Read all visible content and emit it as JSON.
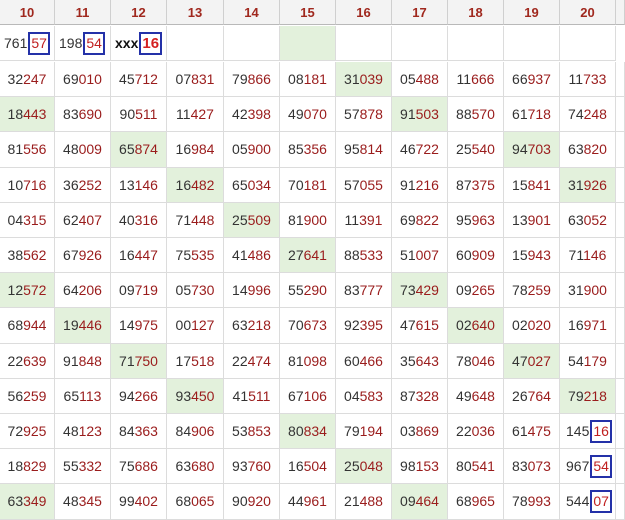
{
  "headers": [
    "10",
    "11",
    "12",
    "13",
    "14",
    "15",
    "16",
    "17",
    "18",
    "19",
    "20"
  ],
  "first_row": [
    {
      "prefix": "761",
      "boxed": "57"
    },
    {
      "prefix": "198",
      "boxed": "54"
    },
    {
      "prefix": "xxx",
      "boxed": "16"
    },
    {
      "text": ""
    },
    {
      "text": ""
    },
    {
      "text": "",
      "highlight": true
    },
    {
      "text": ""
    },
    {
      "text": ""
    },
    {
      "text": ""
    },
    {
      "text": ""
    },
    {
      "text": ""
    }
  ],
  "rows": [
    [
      "32247",
      "69010",
      "45712",
      "07831",
      "79866",
      "08181",
      "31039",
      "05488",
      "11666",
      "66937",
      "11733"
    ],
    [
      "18443",
      "83690",
      "90511",
      "11427",
      "42398",
      "49070",
      "57878",
      "91503",
      "88570",
      "61718",
      "74248"
    ],
    [
      "81556",
      "48009",
      "65874",
      "16984",
      "05900",
      "85356",
      "95814",
      "46722",
      "25540",
      "94703",
      "63820"
    ],
    [
      "10716",
      "36252",
      "13146",
      "16482",
      "65034",
      "70181",
      "57055",
      "91216",
      "87375",
      "15841",
      "31926"
    ],
    [
      "04315",
      "62407",
      "40316",
      "71448",
      "25509",
      "81900",
      "11391",
      "69822",
      "95963",
      "13901",
      "63052"
    ],
    [
      "38562",
      "67926",
      "16447",
      "75535",
      "41486",
      "27641",
      "88533",
      "51007",
      "60909",
      "15943",
      "71146"
    ],
    [
      "12572",
      "64206",
      "09719",
      "05730",
      "14996",
      "55290",
      "83777",
      "73429",
      "09265",
      "78259",
      "31900"
    ],
    [
      "68944",
      "19446",
      "14975",
      "00127",
      "63218",
      "70673",
      "92395",
      "47615",
      "02640",
      "02020",
      "16971"
    ],
    [
      "22639",
      "91848",
      "71750",
      "17518",
      "22474",
      "81098",
      "60466",
      "35643",
      "78046",
      "47027",
      "54179"
    ],
    [
      "56259",
      "65113",
      "94266",
      "93450",
      "41511",
      "67106",
      "04583",
      "87328",
      "49648",
      "26764",
      "79218"
    ],
    [
      "72925",
      "48123",
      "84363",
      "84906",
      "53853",
      "80834",
      "79194",
      "03869",
      "22036",
      "61475",
      "14516"
    ],
    [
      "18829",
      "55332",
      "75686",
      "63680",
      "93760",
      "16504",
      "25048",
      "98153",
      "80541",
      "83073",
      "96754"
    ],
    [
      "63349",
      "48345",
      "99402",
      "68065",
      "90920",
      "44961",
      "21488",
      "09464",
      "68965",
      "78993",
      "54407"
    ]
  ],
  "highlights": [
    [
      6
    ],
    [
      0,
      7
    ],
    [
      2,
      9
    ],
    [
      3,
      10
    ],
    [
      4
    ],
    [
      5
    ],
    [
      0,
      7
    ],
    [
      1,
      8
    ],
    [
      2,
      9
    ],
    [
      3,
      10
    ],
    [
      5
    ],
    [
      6
    ],
    [
      0,
      7
    ]
  ],
  "boxed_cells": [
    [
      10,
      10
    ],
    [
      11,
      10
    ],
    [
      12,
      10
    ]
  ],
  "colors": {
    "text_primary": "#333333",
    "text_secondary": "#9a1c1c",
    "highlight": "#e3f1dc",
    "box": "#2431a8"
  }
}
